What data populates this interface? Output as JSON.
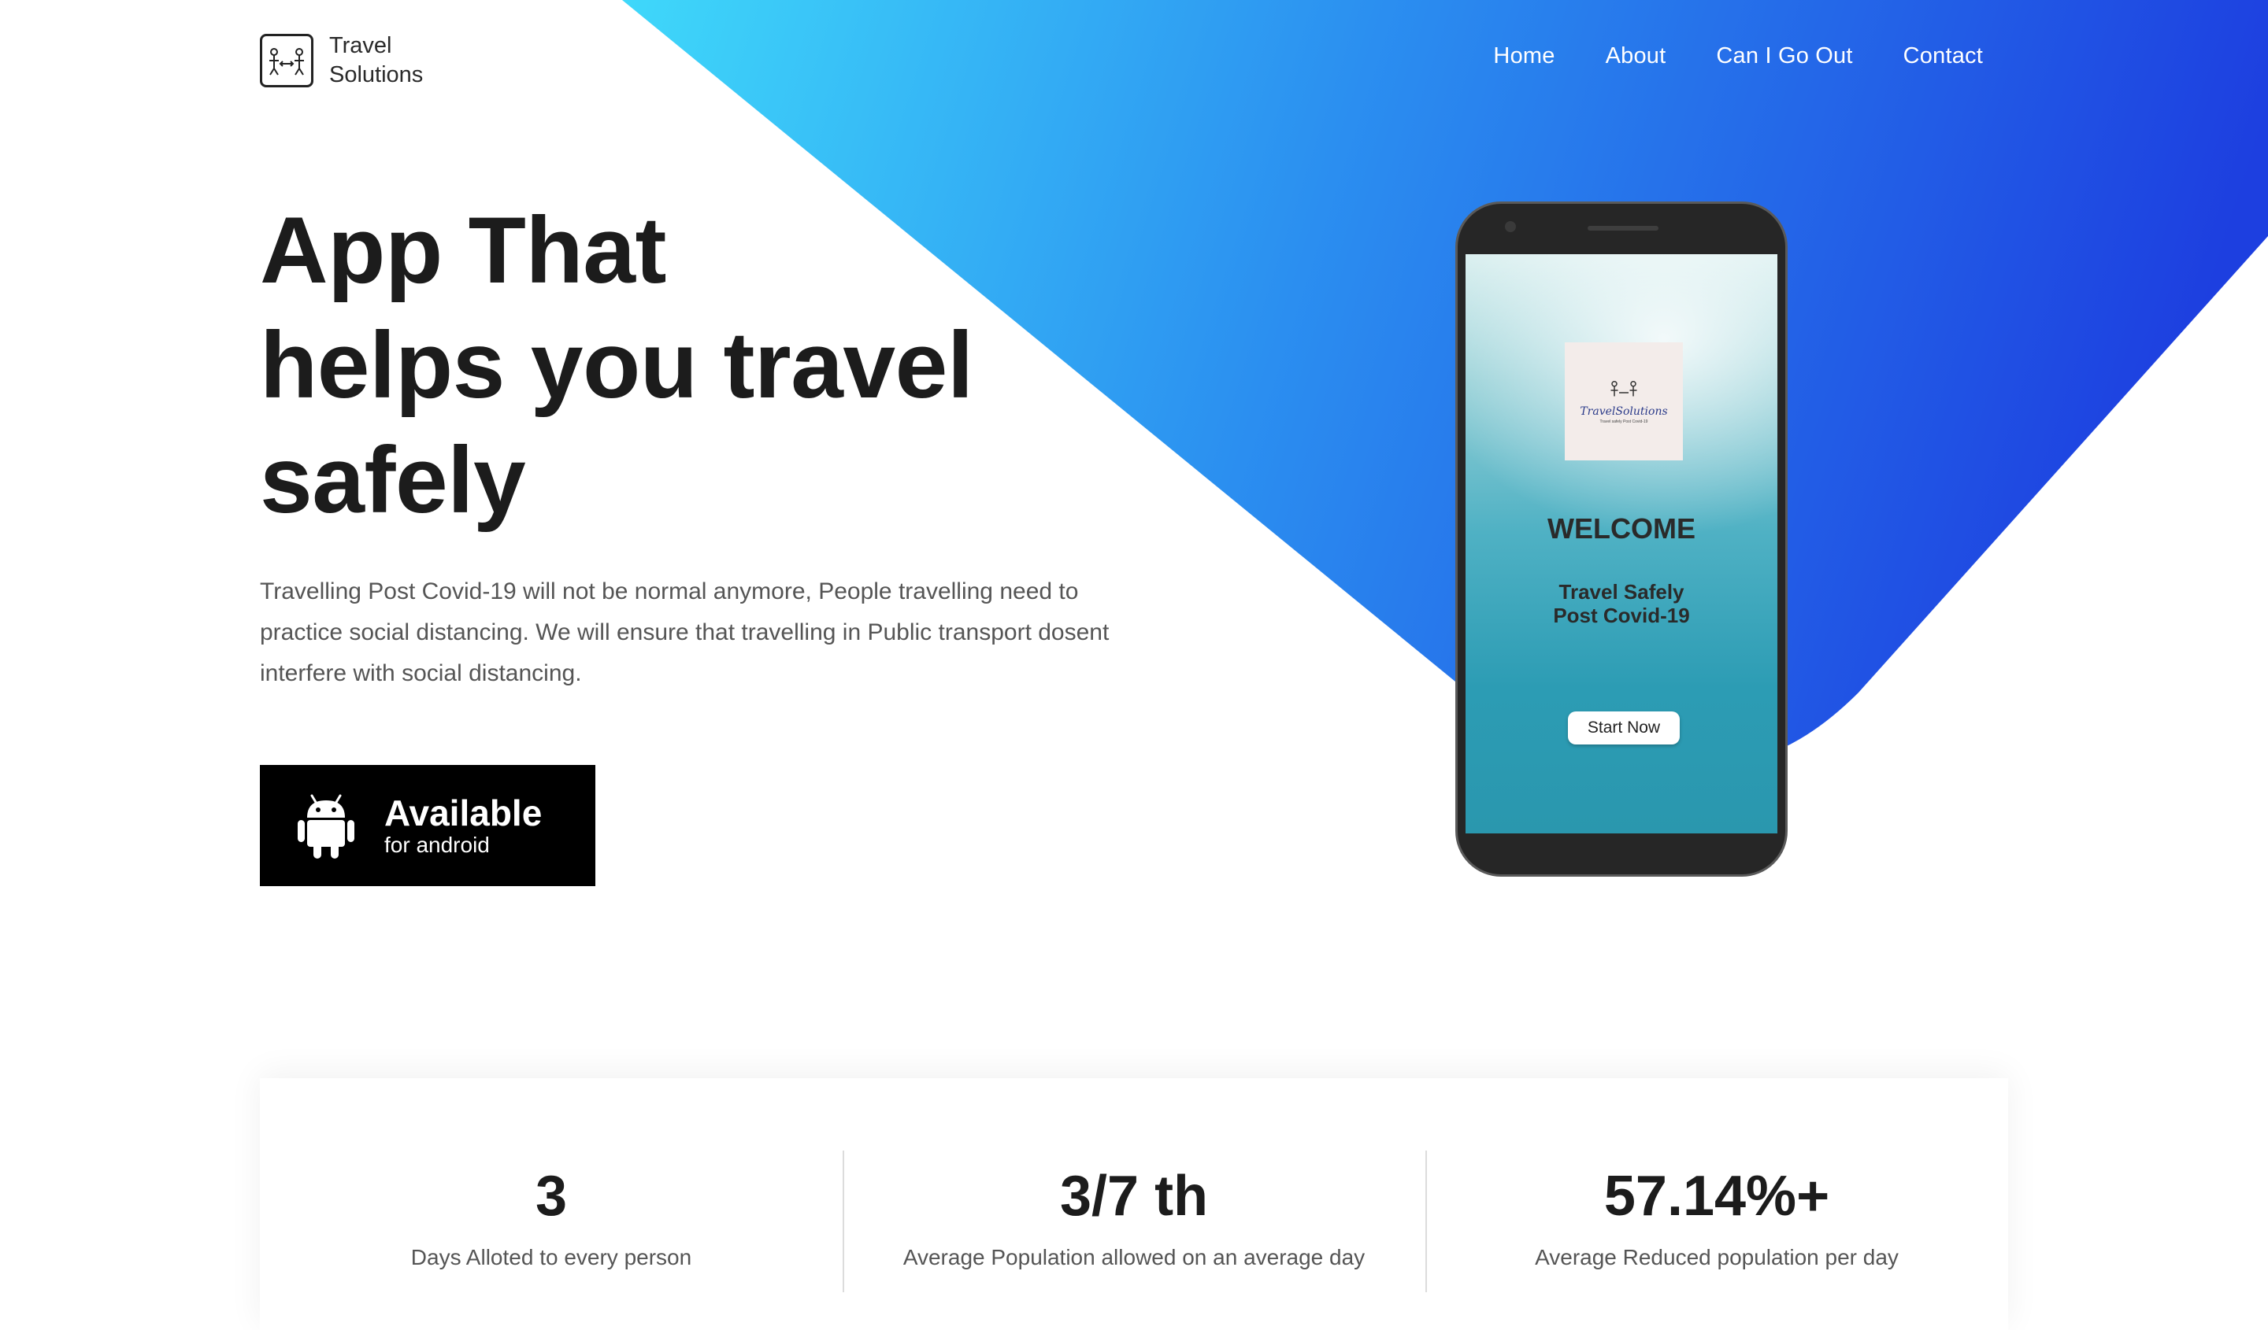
{
  "brand": {
    "name_line1": "Travel",
    "name_line2": "Solutions"
  },
  "nav": {
    "items": [
      {
        "label": "Home"
      },
      {
        "label": "About"
      },
      {
        "label": "Can I Go Out"
      },
      {
        "label": "Contact"
      }
    ]
  },
  "hero": {
    "title_lines": [
      "App That",
      "helps you travel",
      "safely"
    ],
    "description": "Travelling Post Covid-19 will not be normal anymore, People travelling need to practice social distancing. We will ensure that travelling in Public transport dosent interfere with social distancing.",
    "download_button": {
      "main": "Available",
      "sub": "for android",
      "icon": "android-icon"
    }
  },
  "phone_screen": {
    "logo_text": "TravelSolutions",
    "logo_tagline": "Travel safely Post Covid-19",
    "welcome": "WELCOME",
    "subtitle_lines": [
      "Travel Safely",
      "Post Covid-19"
    ],
    "start_button": "Start Now"
  },
  "stats": [
    {
      "value": "3",
      "label": "Days Alloted to every person"
    },
    {
      "value": "3/7 th",
      "label": "Average Population allowed on an average day"
    },
    {
      "value": "57.14%+",
      "label": "Average Reduced population per day"
    }
  ],
  "colors": {
    "gradient_start": "#3fd3f8",
    "gradient_end": "#1d3fe0",
    "text_dark": "#1c1c1c",
    "text_muted": "#555555",
    "button_bg": "#000000"
  }
}
